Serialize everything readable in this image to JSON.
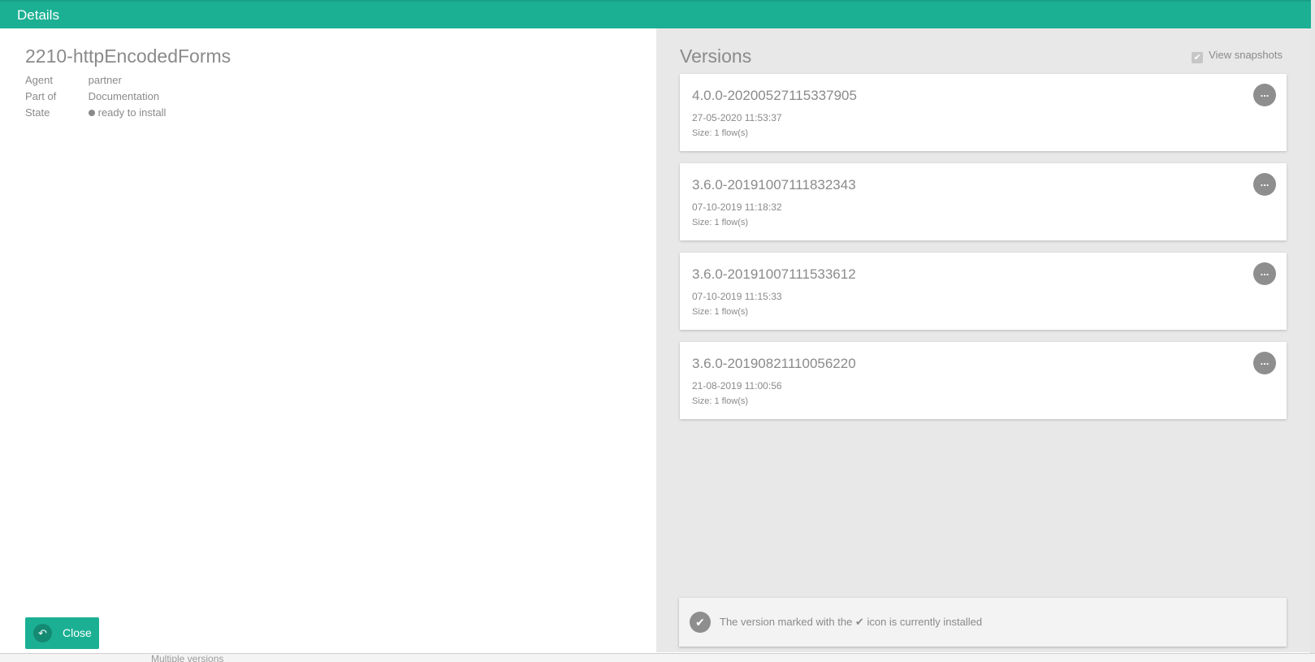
{
  "header": {
    "title": "Details"
  },
  "details": {
    "title": "2210-httpEncodedForms",
    "properties": [
      {
        "label": "Agent",
        "value": "partner"
      },
      {
        "label": "Part of",
        "value": "Documentation"
      },
      {
        "label": "State",
        "value": "ready to install"
      }
    ]
  },
  "actions": {
    "close_label": "Close"
  },
  "versions": {
    "title": "Versions",
    "view_snapshots_label": "View snapshots",
    "view_snapshots_checked": true,
    "items": [
      {
        "name": "4.0.0-20200527115337905",
        "date": "27-05-2020 11:53:37",
        "size": "Size: 1 flow(s)"
      },
      {
        "name": "3.6.0-20191007111832343",
        "date": "07-10-2019 11:18:32",
        "size": "Size: 1 flow(s)"
      },
      {
        "name": "3.6.0-20191007111533612",
        "date": "07-10-2019 11:15:33",
        "size": "Size: 1 flow(s)"
      },
      {
        "name": "3.6.0-20190821110056220",
        "date": "21-08-2019 11:00:56",
        "size": "Size: 1 flow(s)"
      }
    ],
    "more_label": "...",
    "info_before": "The version marked with the",
    "info_after": "icon is currently installed"
  },
  "background": {
    "partial_text": "Multiple versions"
  },
  "colors": {
    "accent": "#1bb093",
    "text": "#8a8a8a",
    "pane_bg": "#e8e8e8"
  },
  "icons": {
    "close": "return-arrow-icon",
    "more": "ellipsis-icon",
    "installed": "checkmark-icon"
  }
}
